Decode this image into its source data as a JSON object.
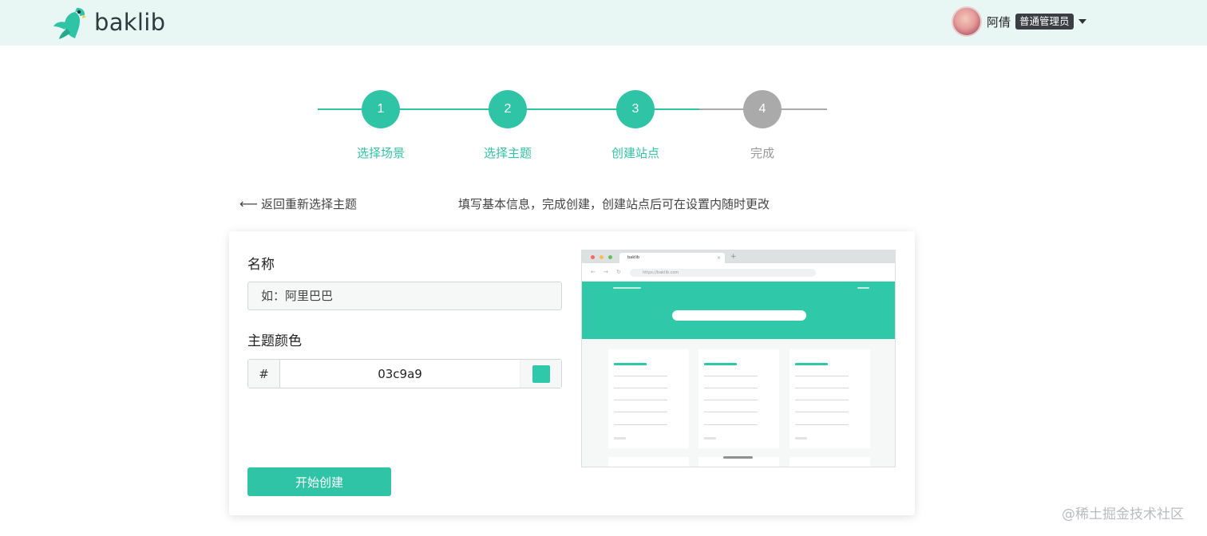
{
  "theme": {
    "accent": "#2fc4a6",
    "inactive": "#aaaaaa",
    "preview_accent": "#2fc9a9"
  },
  "header": {
    "brand": "baklib",
    "logo_icon": "parrot-logo-icon",
    "user": {
      "name": "阿倩",
      "role": "普通管理员"
    }
  },
  "steps": [
    {
      "number": "1",
      "label": "选择场景",
      "state": "done"
    },
    {
      "number": "2",
      "label": "选择主题",
      "state": "done"
    },
    {
      "number": "3",
      "label": "创建站点",
      "state": "active"
    },
    {
      "number": "4",
      "label": "完成",
      "state": "pending"
    }
  ],
  "subheader": {
    "back_label": "返回重新选择主题",
    "hint": "填写基本信息，完成创建，创建站点后可在设置内随时更改"
  },
  "form": {
    "name_label": "名称",
    "name_placeholder": "如：阿里巴巴",
    "color_label": "主题颜色",
    "color_prefix": "#",
    "color_value": "03c9a9",
    "swatch_color": "#2fc9a9",
    "submit_label": "开始创建"
  },
  "preview": {
    "tab_title": "baklib",
    "tab_plus": "+",
    "tab_close": "×",
    "url": "https://baklib.com"
  },
  "watermark": "@稀土掘金技术社区"
}
